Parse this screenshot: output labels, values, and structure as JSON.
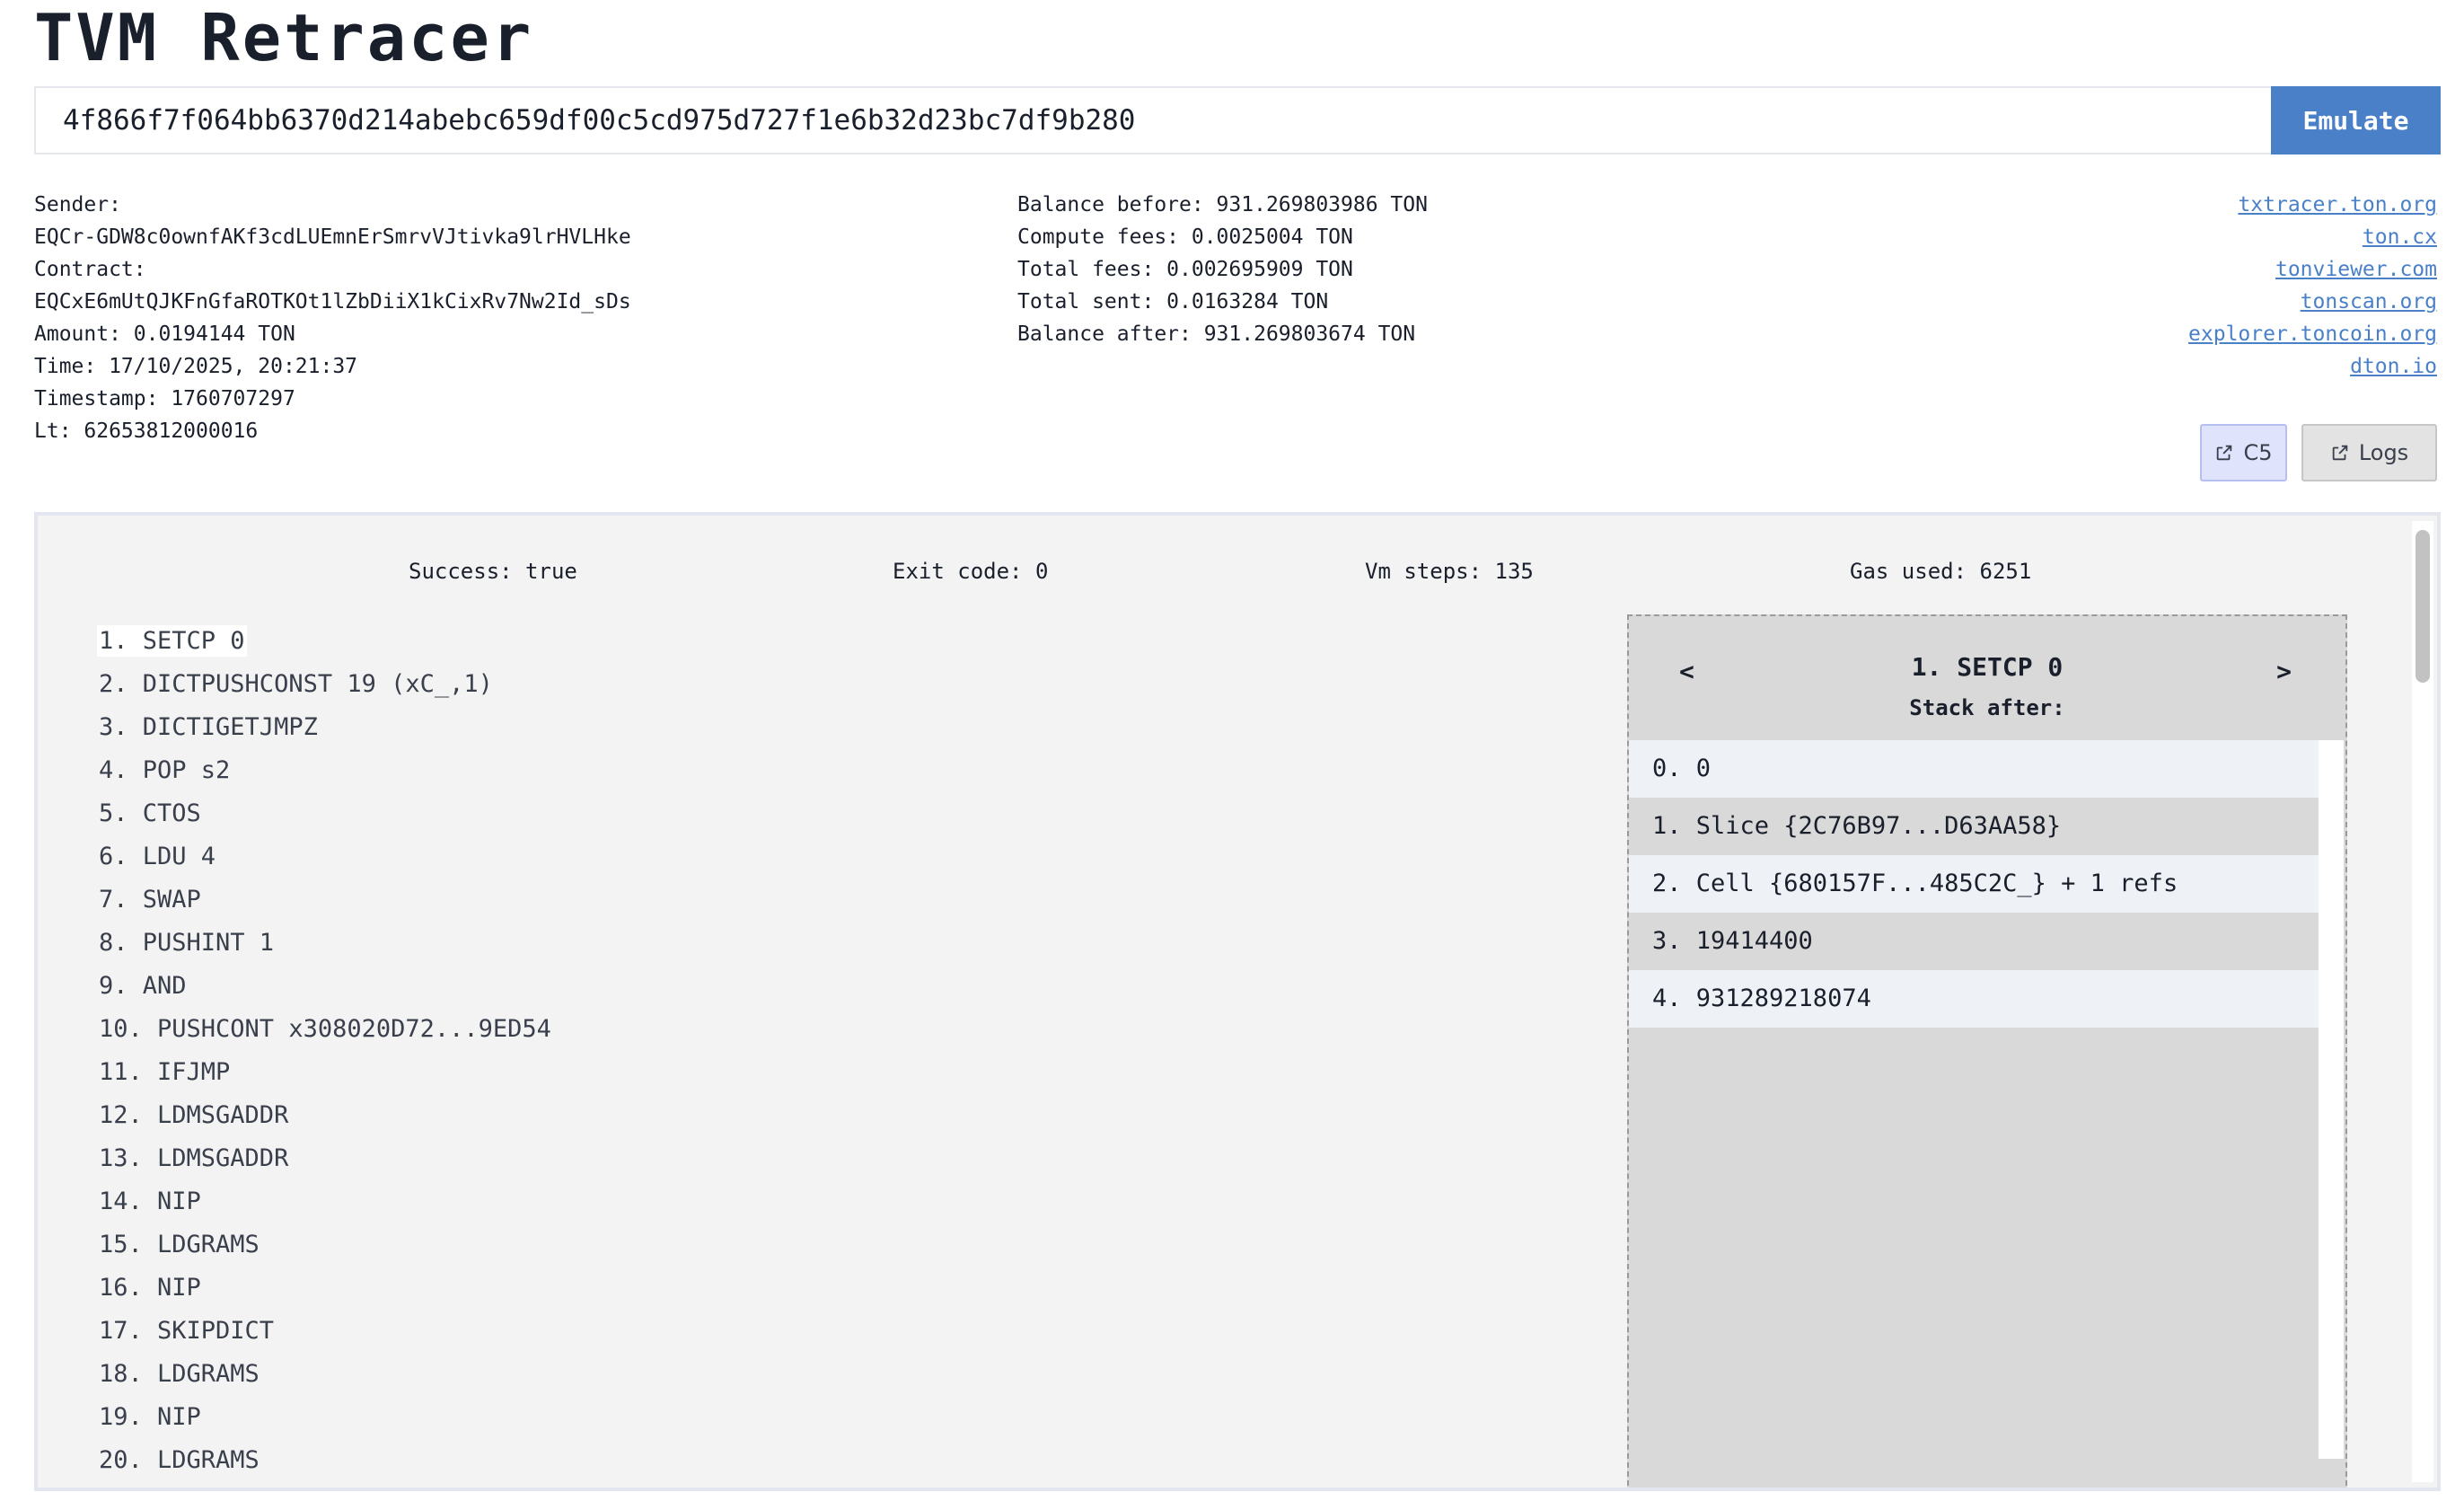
{
  "app": {
    "title": "TVM Retracer"
  },
  "search": {
    "hash": "4f866f7f064bb6370d214abebc659df00c5cd975d727f1e6b32d23bc7df9b280",
    "emulate_label": "Emulate"
  },
  "tx_info": [
    "Sender:",
    "EQCr-GDW8c0ownfAKf3cdLUEmnErSmrvVJtivka9lrHVLHke",
    "Contract:",
    "EQCxE6mUtQJKFnGfaROTKOt1lZbDiiX1kCixRv7Nw2Id_sDs",
    "Amount: 0.0194144 TON",
    "Time: 17/10/2025, 20:21:37",
    "Timestamp: 1760707297",
    "Lt: 62653812000016"
  ],
  "fees": [
    "Balance before: 931.269803986 TON",
    "Compute fees: 0.0025004 TON",
    "Total fees: 0.002695909 TON",
    "Total sent: 0.0163284 TON",
    "Balance after: 931.269803674 TON"
  ],
  "explorer_links": [
    "txtracer.ton.org",
    "ton.cx",
    "tonviewer.com",
    "tonscan.org",
    "explorer.toncoin.org",
    "dton.io"
  ],
  "actions": {
    "c5_label": "C5",
    "logs_label": "Logs"
  },
  "stats": {
    "success": "Success: true",
    "exit_code": "Exit code: 0",
    "vm_steps": "Vm steps: 135",
    "gas_used": "Gas used: 6251"
  },
  "instructions": [
    "1. SETCP 0",
    "2. DICTPUSHCONST 19 (xC_,1)",
    "3. DICTIGETJMPZ",
    "4. POP s2",
    "5. CTOS",
    "6. LDU 4",
    "7. SWAP",
    "8. PUSHINT 1",
    "9. AND",
    "10. PUSHCONT x308020D72...9ED54",
    "11. IFJMP",
    "12. LDMSGADDR",
    "13. LDMSGADDR",
    "14. NIP",
    "15. LDGRAMS",
    "16. NIP",
    "17. SKIPDICT",
    "18. LDGRAMS",
    "19. NIP",
    "20. LDGRAMS"
  ],
  "stack_view": {
    "prev_label": "<",
    "next_label": ">",
    "current": "1. SETCP 0",
    "subtitle": "Stack after:",
    "items": [
      "0. 0",
      "1. Slice {2C76B97...D63AA58}",
      "2. Cell {680157F...485C2C_} + 1 refs",
      "3. 19414400",
      "4. 931289218074"
    ]
  }
}
